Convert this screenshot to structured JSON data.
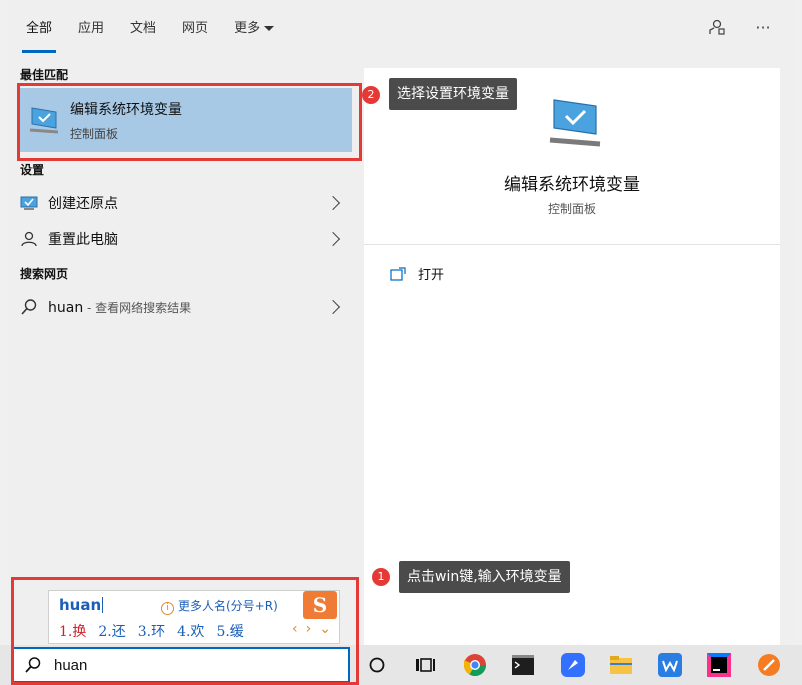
{
  "tabs": [
    {
      "label": "全部",
      "active": true
    },
    {
      "label": "应用",
      "active": false
    },
    {
      "label": "文档",
      "active": false
    },
    {
      "label": "网页",
      "active": false
    },
    {
      "label": "更多",
      "active": false
    }
  ],
  "top_icons": [
    "feedback-icon",
    "more-icon"
  ],
  "more_symbol": "···",
  "best_match": {
    "section": "最佳匹配",
    "title": "编辑系统环境变量",
    "subtitle": "控制面板",
    "icon": "monitor-check-icon"
  },
  "settings": {
    "section": "设置",
    "items": [
      {
        "label": "创建还原点",
        "icon": "monitor-check-icon"
      },
      {
        "label": "重置此电脑",
        "icon": "reset-pc-icon"
      }
    ]
  },
  "web_search": {
    "section": "搜索网页",
    "query": "huan",
    "suffix": " - 查看网络搜索结果",
    "icon": "search-icon"
  },
  "detail": {
    "title": "编辑系统环境变量",
    "subtitle": "控制面板",
    "open_label": "打开",
    "icon": "monitor-check-icon"
  },
  "annotations": [
    {
      "number": "2",
      "text": "选择设置环境变量"
    },
    {
      "number": "1",
      "text": "点击win键,输入环境变量"
    }
  ],
  "ime": {
    "composition": "huan",
    "hint": "更多人名(分号+R)",
    "candidates": [
      "1.换",
      "2.还",
      "3.环",
      "4.欢",
      "5.缓"
    ],
    "nav": [
      "‹",
      "›",
      "⌄"
    ],
    "logo": "S"
  },
  "search": {
    "value": "huan"
  },
  "taskbar_icons": [
    "task-view-icon",
    "multitask-icon",
    "chrome-icon",
    "terminal-icon",
    "feishu-icon",
    "file-explorer-icon",
    "wps-icon",
    "intellij-icon",
    "app-icon"
  ],
  "colors": {
    "accent": "#0067c0",
    "selection": "#a8c9e6",
    "annotation_red": "#e53935",
    "callout_bg": "#4b4b4b"
  }
}
